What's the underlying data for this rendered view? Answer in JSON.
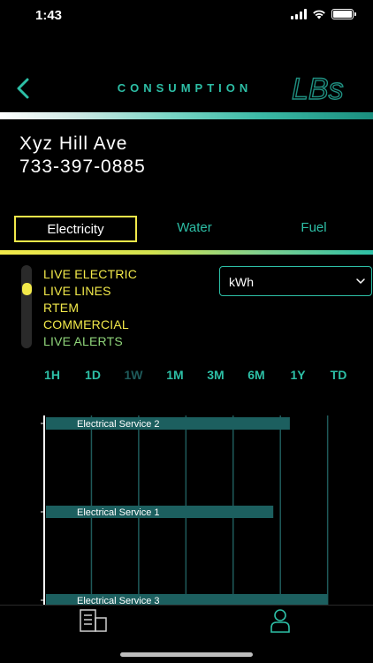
{
  "status_bar": {
    "time": "1:43"
  },
  "header": {
    "title": "CONSUMPTION",
    "logo_text": "LBs"
  },
  "address": {
    "street": "Xyz Hill Ave",
    "phone": "733-397-0885"
  },
  "tabs": [
    {
      "label": "Electricity",
      "selected": true
    },
    {
      "label": "Water",
      "selected": false
    },
    {
      "label": "Fuel",
      "selected": false
    }
  ],
  "feeds": [
    {
      "label": "LIVE ELECTRIC",
      "color": "#f2e94a"
    },
    {
      "label": "LIVE LINES",
      "color": "#f2e94a"
    },
    {
      "label": "RTEM",
      "color": "#f2e94a"
    },
    {
      "label": "COMMERCIAL",
      "color": "#f2e94a"
    },
    {
      "label": "LIVE ALERTS",
      "color": "#8fd47a"
    }
  ],
  "unit_select": {
    "value": "kWh"
  },
  "time_ranges": [
    {
      "label": "1H",
      "active": false
    },
    {
      "label": "1D",
      "active": false
    },
    {
      "label": "1W",
      "active": true
    },
    {
      "label": "1M",
      "active": false
    },
    {
      "label": "3M",
      "active": false
    },
    {
      "label": "6M",
      "active": false
    },
    {
      "label": "1Y",
      "active": false
    },
    {
      "label": "TD",
      "active": false
    }
  ],
  "chart_data": {
    "type": "bar",
    "orientation": "horizontal",
    "categories": [
      "Electrical Service 2",
      "Electrical Service 1",
      "Electrical Service 3"
    ],
    "values": [
      5.2,
      4.85,
      6.0
    ],
    "xlim": [
      0,
      6.1
    ],
    "grid": true,
    "bar_color": "#1c5f5f"
  },
  "colors": {
    "accent": "#2dbfa6",
    "highlight": "#f2e94a",
    "inactive_range": "#1e5a5a"
  },
  "tab_bar": [
    {
      "icon": "building-icon",
      "label": ""
    },
    {
      "icon": "user-icon",
      "label": ""
    }
  ]
}
